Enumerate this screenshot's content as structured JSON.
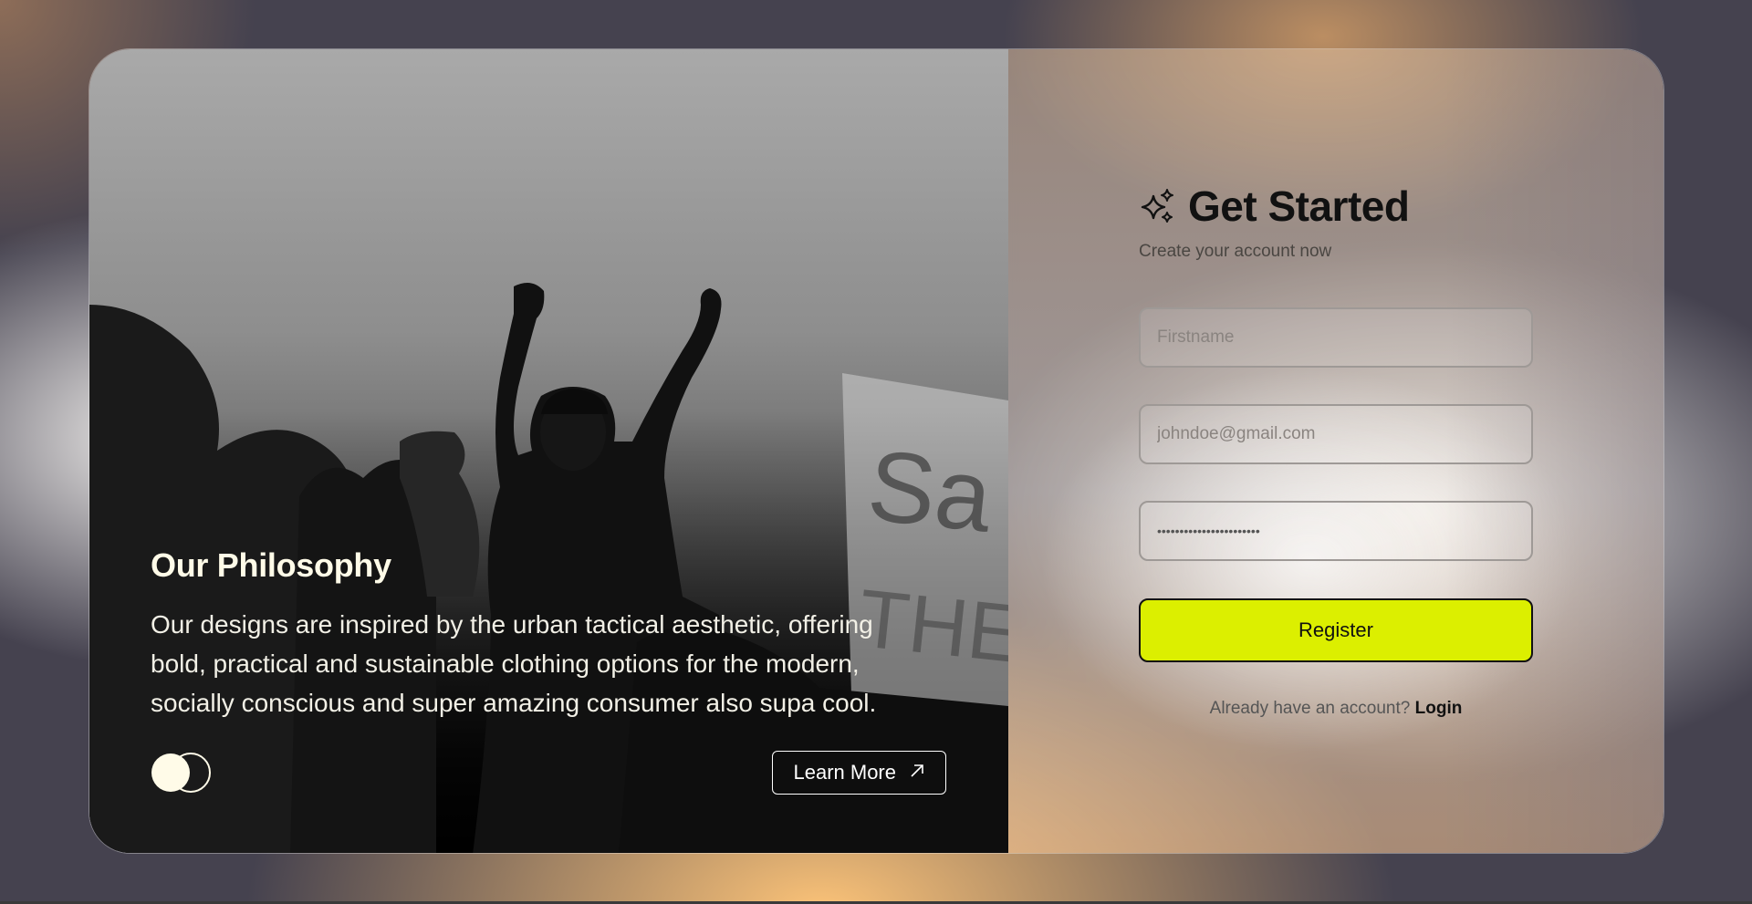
{
  "left_panel": {
    "title": "Our Philosophy",
    "body": "Our designs are inspired by the urban tactical aesthetic, offering bold, practical and sustainable clothing options for the modern, socially conscious and super amazing consumer also supa cool.",
    "learn_more_label": "Learn More",
    "learn_more_icon": "arrow-up-right-icon",
    "logo_icon": "overlapping-circles-logo",
    "photo_sign_text": "SaY THEIR"
  },
  "form": {
    "title": "Get Started",
    "title_icon": "sparkles-icon",
    "subtitle": "Create your account now",
    "firstname_placeholder": "Firstname",
    "email_placeholder": "johndoe@gmail.com",
    "password_value": "•••••••••••••••••••••••",
    "register_label": "Register",
    "login_prompt": "Already have an account?",
    "login_label": "Login"
  },
  "colors": {
    "accent": "#dcef00",
    "text_dark": "#111111",
    "text_light": "#fffbe8"
  }
}
